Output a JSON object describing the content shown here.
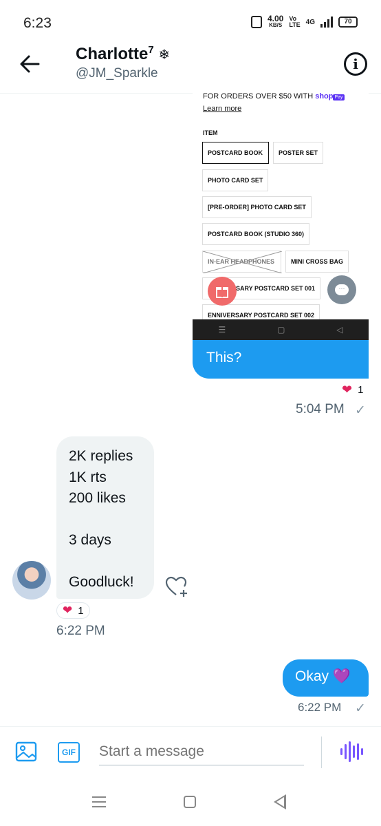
{
  "status_bar": {
    "time": "6:23",
    "speed_value": "4.00",
    "speed_unit": "KB/S",
    "volte_top": "Vo",
    "volte_bottom": "LTE",
    "network": "4G",
    "battery": "70"
  },
  "header": {
    "name": "Charlotte",
    "name_sup": "7",
    "name_emoji": "❄",
    "handle": "@JM_Sparkle"
  },
  "attachment": {
    "promo_text": "FOR ORDERS OVER $50 WITH",
    "promo_brand": "shop",
    "promo_pay": "Pay",
    "learn_more": "Learn more",
    "item_label": "ITEM",
    "options": [
      "POSTCARD BOOK",
      "POSTER SET",
      "PHOTO CARD SET",
      "[PRE-ORDER] PHOTO CARD SET",
      "POSTCARD BOOK (STUDIO 360)",
      "IN-EAR HEADPHONES",
      "MINI CROSS BAG",
      "SARY POSTCARD SET 001",
      "ENNIVERSARY POSTCARD SET 002"
    ]
  },
  "messages": {
    "sent_1": "This?",
    "sent_1_reaction_count": "1",
    "sent_1_time": "5:04 PM",
    "received_lines": [
      "2K replies",
      "1K rts",
      "200 likes",
      "",
      "3 days",
      "",
      "Goodluck!"
    ],
    "received_reaction_count": "1",
    "received_time": "6:22 PM",
    "sent_2": "Okay 💜",
    "sent_2_time": "6:22 PM"
  },
  "composer": {
    "placeholder": "Start a message",
    "gif_label": "GIF"
  },
  "icons": {
    "back": "arrow-left-icon",
    "info": "info-icon",
    "image": "image-icon",
    "gif": "gif-icon",
    "voice": "voice-wave-icon",
    "heart": "heart-icon",
    "like": "heart-plus-icon",
    "check": "check-icon"
  },
  "colors": {
    "accent": "#1d9bf0",
    "bubble_incoming": "#eff3f4",
    "voice": "#7856ff",
    "heart": "#e0245e"
  }
}
